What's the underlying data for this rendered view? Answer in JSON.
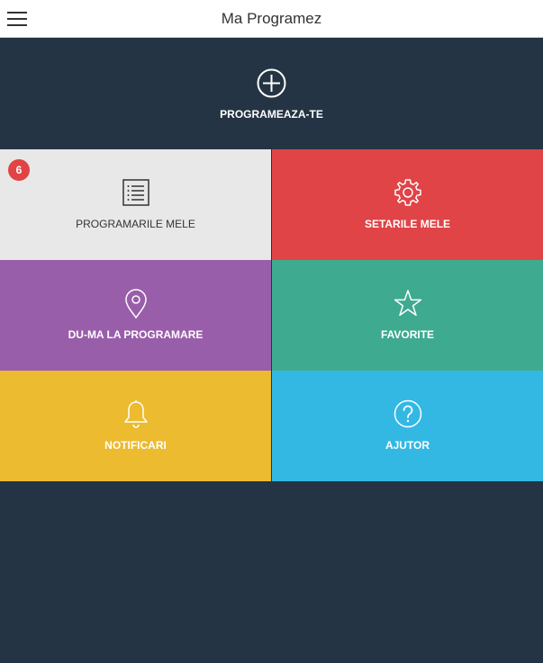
{
  "header": {
    "title": "Ma Programez",
    "menu_icon": "hamburger-menu-icon"
  },
  "hero": {
    "label": "PROGRAMEAZA-TE",
    "icon": "plus-circle-icon"
  },
  "colors": {
    "background": "#253444",
    "appointments": "#e8e8e8",
    "settings": "#e04447",
    "directions": "#995eaa",
    "favorites": "#3eaa8f",
    "notifications": "#ecbb2f",
    "help": "#33b8e4",
    "badge": "#e04444"
  },
  "tiles": [
    {
      "label": "PROGRAMARILE MELE",
      "icon": "list-icon",
      "badge": "6"
    },
    {
      "label": "SETARILE MELE",
      "icon": "gear-icon"
    },
    {
      "label": "DU-MA LA PROGRAMARE",
      "icon": "map-pin-icon"
    },
    {
      "label": "FAVORITE",
      "icon": "star-icon"
    },
    {
      "label": "NOTIFICARI",
      "icon": "bell-icon"
    },
    {
      "label": "AJUTOR",
      "icon": "help-circle-icon"
    }
  ]
}
